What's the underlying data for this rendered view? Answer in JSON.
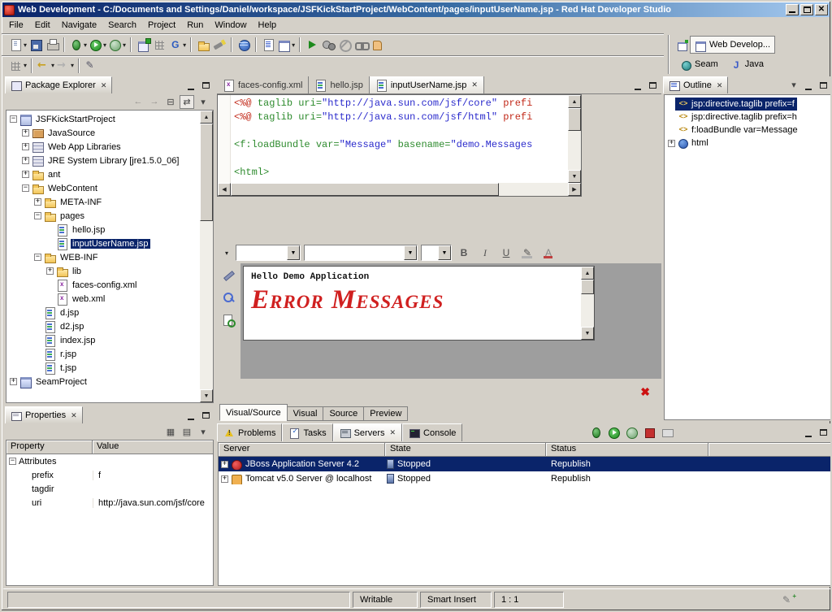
{
  "window": {
    "title": "Web Development - C:/Documents and Settings/Daniel/workspace/JSFKickStartProject/WebContent/pages/inputUserName.jsp - Red Hat Developer Studio"
  },
  "icons": {
    "close": "✕",
    "up": "▲",
    "down": "▼",
    "left": "◀",
    "right": "▶",
    "dropdown": "▾",
    "error": "✖",
    "tag": "<>",
    "plus": "+",
    "minus": "−",
    "pencil": "✎"
  },
  "menubar": {
    "items": [
      "File",
      "Edit",
      "Navigate",
      "Search",
      "Project",
      "Run",
      "Window",
      "Help"
    ]
  },
  "toolbar": {
    "row1": [
      {
        "name": "new-wizard",
        "cls": "ci-page",
        "drop": true
      },
      {
        "name": "save",
        "cls": "ci-save"
      },
      {
        "name": "print",
        "cls": "ci-print"
      },
      {
        "sep": true
      },
      {
        "name": "debug",
        "cls": "ci-bug",
        "drop": true
      },
      {
        "name": "run",
        "cls": "ci-run",
        "drop": true
      },
      {
        "name": "external-tools",
        "cls": "ci-runx",
        "drop": true
      },
      {
        "sep": true
      },
      {
        "name": "new-web-project",
        "cls": "ci-newweb"
      },
      {
        "name": "new-package",
        "cls": "ci-grid"
      },
      {
        "name": "new-getter",
        "cls": "ci-g",
        "drop": true
      },
      {
        "sep": true
      },
      {
        "name": "open-resource",
        "cls": "ci-folder"
      },
      {
        "name": "search",
        "cls": "ci-flash"
      },
      {
        "sep": true
      },
      {
        "name": "web-browser",
        "cls": "ci-globe"
      },
      {
        "sep": true
      },
      {
        "name": "report",
        "cls": "ci-list"
      },
      {
        "name": "show-palette",
        "cls": "ci-win",
        "drop": true
      },
      {
        "sep": true
      },
      {
        "name": "run-on-server",
        "cls": "ci-play"
      },
      {
        "name": "synchronize",
        "cls": "ci-gears"
      },
      {
        "name": "stop",
        "cls": "ci-skip"
      },
      {
        "name": "link-with-editor",
        "cls": "ci-chain"
      },
      {
        "name": "drag-hand",
        "cls": "ci-hand"
      }
    ],
    "row2": [
      {
        "name": "show-grid",
        "cls": "ci-grid2",
        "drop": true
      },
      {
        "sep": true
      },
      {
        "name": "back-history",
        "cls": "ci-arrow-left",
        "drop": true
      },
      {
        "name": "forward-history",
        "cls": "ci-arrow-right",
        "drop": true
      },
      {
        "sep": true
      },
      {
        "name": "mark-occurrences",
        "cls": "ci-pen"
      }
    ]
  },
  "perspectives": {
    "items": [
      {
        "label": "Web Develop...",
        "icon": "pi-web",
        "active": true
      },
      {
        "label": "Seam",
        "icon": "pi-seam",
        "active": false
      },
      {
        "label": "Java",
        "icon": "pi-java",
        "active": false
      }
    ]
  },
  "package_explorer": {
    "title": "Package Explorer",
    "tools": [
      {
        "name": "back",
        "glyph": "←",
        "dim": true
      },
      {
        "name": "forward",
        "glyph": "→",
        "dim": true
      },
      {
        "name": "collapse-all",
        "glyph": "⊟"
      },
      {
        "name": "link-with-editor",
        "glyph": "⇄",
        "pressed": true
      },
      {
        "name": "view-menu",
        "glyph": "▾"
      }
    ],
    "tree": [
      {
        "label": "JSFKickStartProject",
        "level": 0,
        "expander": "minus",
        "icon": "project"
      },
      {
        "label": "JavaSource",
        "level": 1,
        "expander": "plus",
        "icon": "package"
      },
      {
        "label": "Web App Libraries",
        "level": 1,
        "expander": "plus",
        "icon": "lib"
      },
      {
        "label": "JRE System Library [jre1.5.0_06]",
        "level": 1,
        "expander": "plus",
        "icon": "lib"
      },
      {
        "label": "ant",
        "level": 1,
        "expander": "plus",
        "icon": "folder"
      },
      {
        "label": "WebContent",
        "level": 1,
        "expander": "minus",
        "icon": "folder"
      },
      {
        "label": "META-INF",
        "level": 2,
        "expander": "plus",
        "icon": "folder"
      },
      {
        "label": "pages",
        "level": 2,
        "expander": "minus",
        "icon": "folder"
      },
      {
        "label": "hello.jsp",
        "level": 3,
        "icon": "jsp"
      },
      {
        "label": "inputUserName.jsp",
        "level": 3,
        "icon": "jsp",
        "selected": true
      },
      {
        "label": "WEB-INF",
        "level": 2,
        "expander": "minus",
        "icon": "folder"
      },
      {
        "label": "lib",
        "level": 3,
        "expander": "plus",
        "icon": "folder"
      },
      {
        "label": "faces-config.xml",
        "level": 3,
        "icon": "xml"
      },
      {
        "label": "web.xml",
        "level": 3,
        "icon": "xml"
      },
      {
        "label": "d.jsp",
        "level": 2,
        "icon": "jsp"
      },
      {
        "label": "d2.jsp",
        "level": 2,
        "icon": "jsp"
      },
      {
        "label": "index.jsp",
        "level": 2,
        "icon": "jsp"
      },
      {
        "label": "r.jsp",
        "level": 2,
        "icon": "jsp"
      },
      {
        "label": "t.jsp",
        "level": 2,
        "icon": "jsp"
      },
      {
        "label": "SeamProject",
        "level": 0,
        "expander": "plus",
        "icon": "project"
      }
    ]
  },
  "properties_view": {
    "title": "Properties",
    "tools": [
      {
        "name": "show-categories",
        "glyph": "▦"
      },
      {
        "name": "filter-advanced",
        "glyph": "▤"
      },
      {
        "name": "view-menu",
        "glyph": "▾"
      }
    ],
    "columns": [
      "Property",
      "Value"
    ],
    "rows": [
      {
        "property": "Attributes",
        "value": "",
        "level": 0,
        "expander": "minus"
      },
      {
        "property": "prefix",
        "value": "f",
        "level": 1
      },
      {
        "property": "tagdir",
        "value": "",
        "level": 1
      },
      {
        "property": "uri",
        "value": "http://java.sun.com/jsf/core",
        "level": 1
      }
    ]
  },
  "editor": {
    "tabs": [
      {
        "label": "faces-config.xml",
        "icon": "xml",
        "active": false
      },
      {
        "label": "hello.jsp",
        "icon": "jsp",
        "active": false
      },
      {
        "label": "inputUserName.jsp",
        "icon": "jsp",
        "active": true
      }
    ],
    "source": {
      "lines": [
        [
          {
            "t": "<%@",
            "c": "r"
          },
          {
            "t": " ",
            "c": "k"
          },
          {
            "t": "taglib",
            "c": "g"
          },
          {
            "t": " ",
            "c": "k"
          },
          {
            "t": "uri=",
            "c": "g"
          },
          {
            "t": "\"http://java.sun.com/jsf/core\"",
            "c": "b"
          },
          {
            "t": " ",
            "c": "k"
          },
          {
            "t": "prefi",
            "c": "r"
          }
        ],
        [
          {
            "t": "<%@",
            "c": "r"
          },
          {
            "t": " ",
            "c": "k"
          },
          {
            "t": "taglib",
            "c": "g"
          },
          {
            "t": " ",
            "c": "k"
          },
          {
            "t": "uri=",
            "c": "g"
          },
          {
            "t": "\"http://java.sun.com/jsf/html\"",
            "c": "b"
          },
          {
            "t": " ",
            "c": "k"
          },
          {
            "t": "prefi",
            "c": "r"
          }
        ],
        [],
        [
          {
            "t": "<f:loadBundle",
            "c": "g"
          },
          {
            "t": " ",
            "c": "k"
          },
          {
            "t": "var=",
            "c": "g"
          },
          {
            "t": "\"Message\"",
            "c": "b"
          },
          {
            "t": " ",
            "c": "k"
          },
          {
            "t": "basename=",
            "c": "g"
          },
          {
            "t": "\"demo.Messages",
            "c": "b"
          }
        ],
        [],
        [
          {
            "t": "<html>",
            "c": "g"
          }
        ]
      ]
    },
    "visual": {
      "combos": [
        "",
        "",
        ""
      ],
      "bold_label": "B",
      "italic_label": "I",
      "underline_label": "U",
      "hello_text": "Hello Demo Application",
      "error_text": "Error Messages"
    },
    "bottom_tabs": [
      {
        "label": "Visual/Source",
        "active": true
      },
      {
        "label": "Visual",
        "active": false
      },
      {
        "label": "Source",
        "active": false
      },
      {
        "label": "Preview",
        "active": false
      }
    ]
  },
  "outline": {
    "title": "Outline",
    "tools": [
      {
        "name": "view-menu",
        "glyph": "▾"
      }
    ],
    "items": [
      {
        "label": "jsp:directive.taglib prefix=f",
        "icon": "tag",
        "selected": true
      },
      {
        "label": "jsp:directive.taglib prefix=h",
        "icon": "tag",
        "selected": false
      },
      {
        "label": "f:loadBundle var=Message",
        "icon": "tag",
        "selected": false
      },
      {
        "label": "html",
        "icon": "html",
        "expander": "plus",
        "selected": false
      }
    ]
  },
  "bottom_panel": {
    "tabs": [
      {
        "label": "Problems",
        "icon": "problems",
        "active": false
      },
      {
        "label": "Tasks",
        "icon": "tasks",
        "active": false
      },
      {
        "label": "Servers",
        "icon": "servers",
        "active": true
      },
      {
        "label": "Console",
        "icon": "console",
        "active": false
      }
    ],
    "toolbar": [
      {
        "name": "debug-server",
        "cls": "ci-bug"
      },
      {
        "name": "start-server",
        "cls": "ci-run"
      },
      {
        "name": "profile-server",
        "cls": "ci-runx"
      },
      {
        "name": "stop-server",
        "cls": "ci-stopred"
      },
      {
        "name": "publish-server",
        "cls": "ci-pub"
      }
    ],
    "servers": {
      "columns": [
        "Server",
        "State",
        "Status"
      ],
      "rows": [
        {
          "server": "JBoss Application Server 4.2",
          "icon": "jboss",
          "state": "Stopped",
          "status": "Republish",
          "selected": true
        },
        {
          "server": "Tomcat v5.0 Server @ localhost",
          "icon": "tomcat",
          "state": "Stopped",
          "status": "Republish",
          "selected": false
        }
      ]
    }
  },
  "statusbar": {
    "message": "",
    "writable": "Writable",
    "insert_mode": "Smart Insert",
    "position": "1 : 1"
  }
}
